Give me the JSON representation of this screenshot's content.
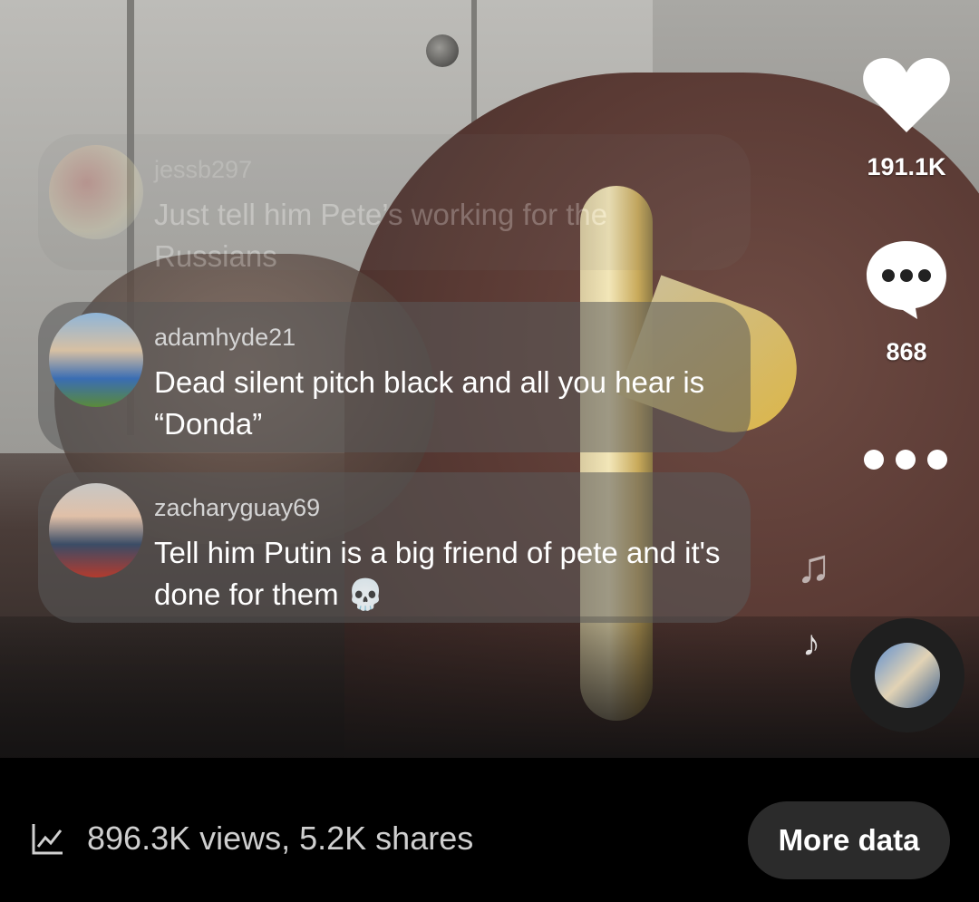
{
  "comments": [
    {
      "user": "jessb297",
      "text": "Just tell him Pete’s working for the Russians"
    },
    {
      "user": "adamhyde21",
      "text": "Dead silent pitch black and all you hear is “Donda”"
    },
    {
      "user": "zacharyguay69",
      "text": "Tell him Putin is a big friend of pete and it's done for them 💀"
    }
  ],
  "actions": {
    "likes": "191.1K",
    "comments": "868"
  },
  "icons": {
    "like": "heart-icon",
    "comment": "comment-bubble-icon",
    "more": "more-dots-icon",
    "music": "music-note-icon",
    "stats": "line-chart-icon"
  },
  "footer": {
    "stats": "896.3K views, 5.2K shares",
    "more_button": "More data"
  }
}
